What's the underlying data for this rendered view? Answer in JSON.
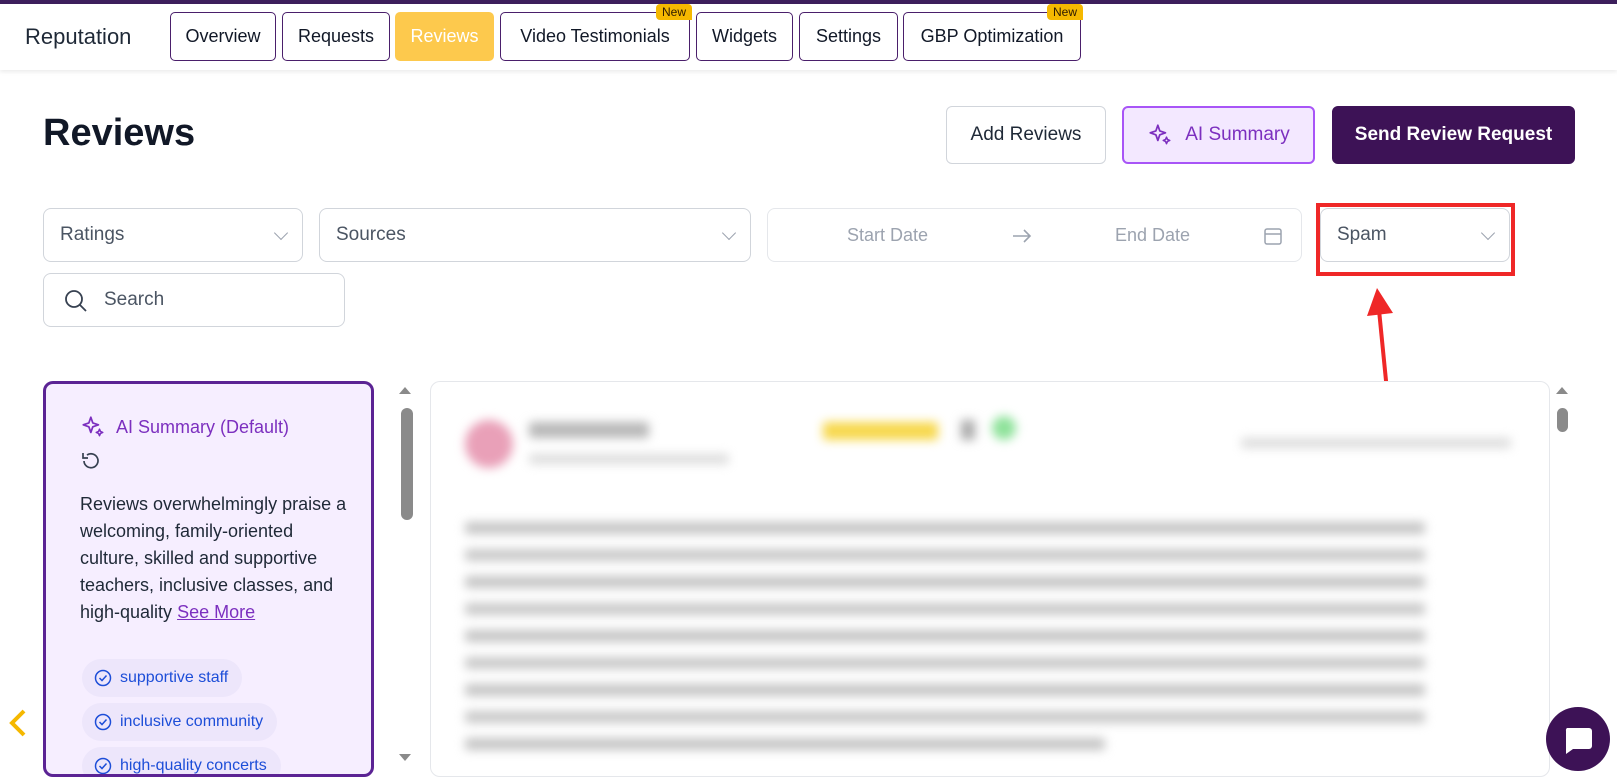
{
  "app": {
    "title": "Reputation"
  },
  "tabs": [
    {
      "label": "Overview"
    },
    {
      "label": "Requests"
    },
    {
      "label": "Reviews"
    },
    {
      "label": "Video Testimonials",
      "badge": "New"
    },
    {
      "label": "Widgets"
    },
    {
      "label": "Settings"
    },
    {
      "label": "GBP Optimization",
      "badge": "New"
    }
  ],
  "active_tab": "Reviews",
  "page": {
    "title": "Reviews"
  },
  "actions": {
    "add_reviews": "Add Reviews",
    "ai_summary": "AI Summary",
    "send_request": "Send Review Request"
  },
  "filters": {
    "ratings": "Ratings",
    "sources": "Sources",
    "start_date": "Start Date",
    "end_date": "End Date",
    "spam": "Spam",
    "search_placeholder": "Search"
  },
  "ai_summary": {
    "title": "AI Summary (Default)",
    "text": "Reviews overwhelmingly praise a welcoming, family-oriented culture, skilled and supportive teachers, inclusive classes, and high-quality ",
    "see_more": "See More",
    "tags": [
      "supportive staff",
      "inclusive community",
      "high-quality concerts"
    ]
  },
  "colors": {
    "brand": "#3d1256",
    "active_tab": "#fdc94d",
    "accent_purple": "#7c2fbf",
    "highlight": "#ef2727",
    "tag_text": "#1d4ed8"
  }
}
